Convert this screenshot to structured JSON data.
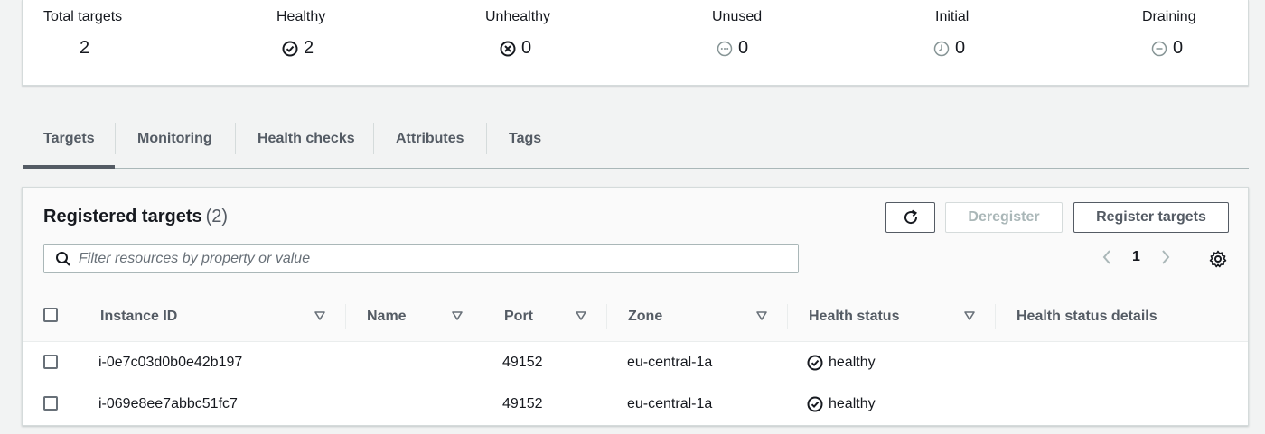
{
  "summary": [
    {
      "label": "Total targets",
      "value": "2",
      "icon": ""
    },
    {
      "label": "Healthy",
      "value": "2",
      "icon": "check-circle-icon"
    },
    {
      "label": "Unhealthy",
      "value": "0",
      "icon": "x-circle-icon"
    },
    {
      "label": "Unused",
      "value": "0",
      "icon": "dots-circle-icon"
    },
    {
      "label": "Initial",
      "value": "0",
      "icon": "clock-circle-icon"
    },
    {
      "label": "Draining",
      "value": "0",
      "icon": "minus-circle-icon"
    }
  ],
  "tabs": [
    {
      "label": "Targets",
      "active": true
    },
    {
      "label": "Monitoring",
      "active": false
    },
    {
      "label": "Health checks",
      "active": false
    },
    {
      "label": "Attributes",
      "active": false
    },
    {
      "label": "Tags",
      "active": false
    }
  ],
  "panel": {
    "title": "Registered targets",
    "count": "(2)",
    "refresh_icon": "refresh-icon",
    "deregister_label": "Deregister",
    "register_label": "Register targets",
    "search_placeholder": "Filter resources by property or value",
    "page_number": "1"
  },
  "table": {
    "columns": [
      "Instance ID",
      "Name",
      "Port",
      "Zone",
      "Health status",
      "Health status details"
    ],
    "rows": [
      {
        "instance_id": "i-0e7c03d0b0e42b197",
        "name": "",
        "port": "49152",
        "zone": "eu-central-1a",
        "health_status": "healthy",
        "details": ""
      },
      {
        "instance_id": "i-069e8ee7abbc51fc7",
        "name": "",
        "port": "49152",
        "zone": "eu-central-1a",
        "health_status": "healthy",
        "details": ""
      }
    ]
  },
  "colors": {
    "text": "#16191f",
    "secondary": "#545b64",
    "border": "#d5dbdb"
  }
}
